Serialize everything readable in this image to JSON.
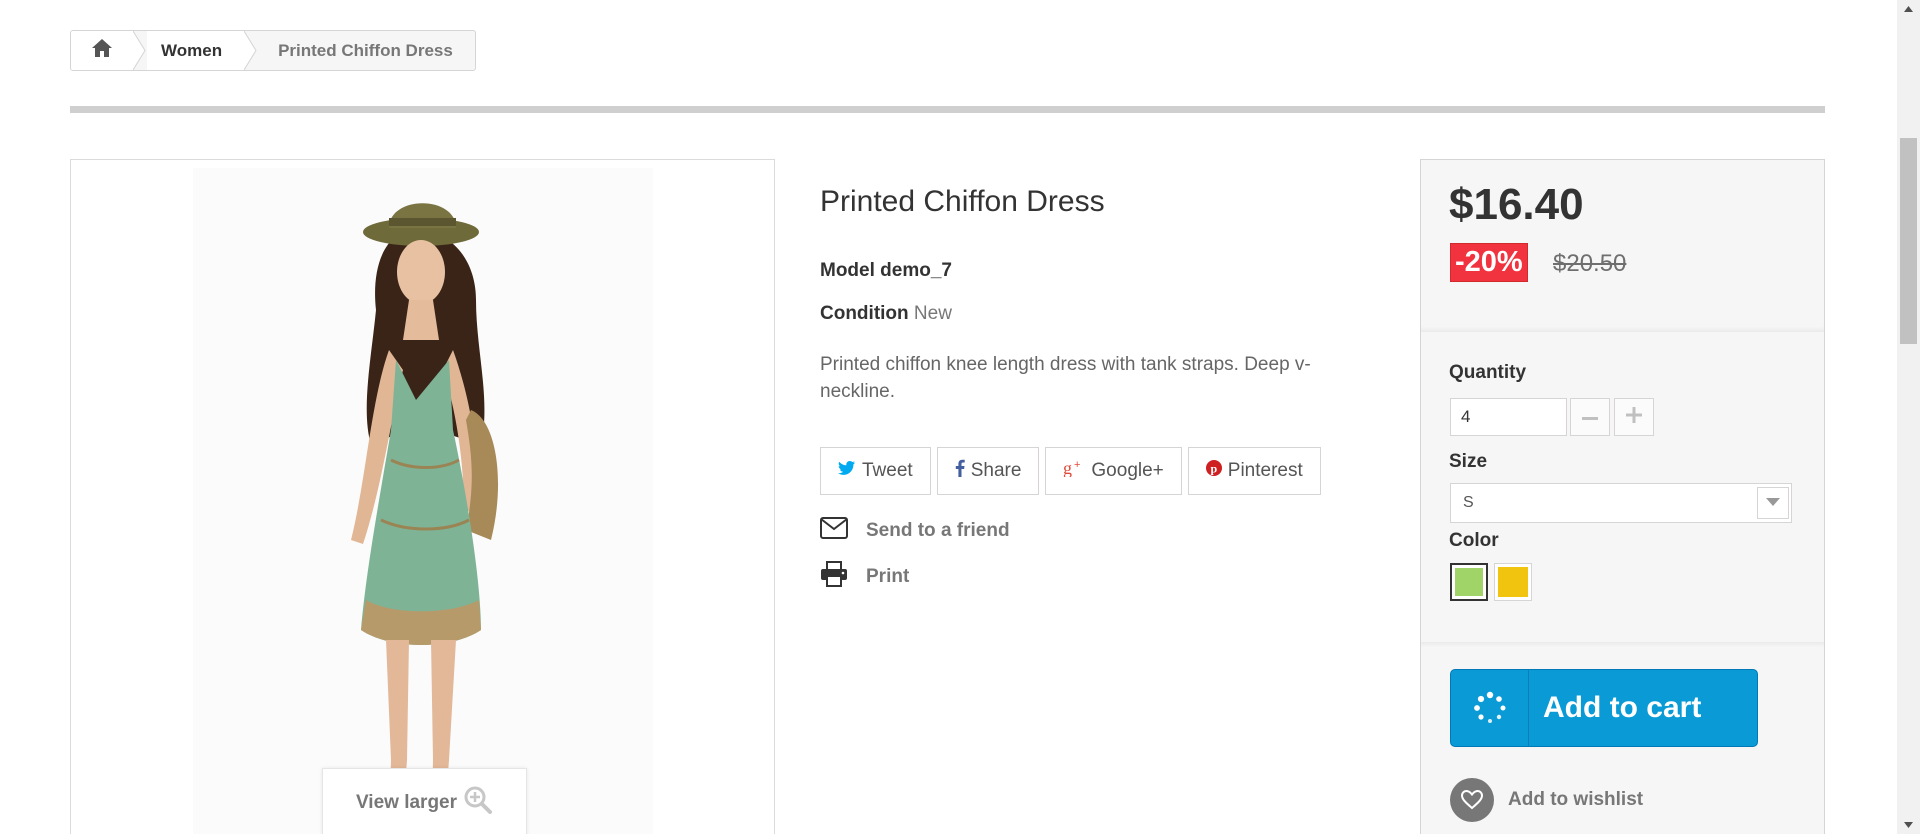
{
  "breadcrumb": {
    "home_icon": "home-icon",
    "women": "Women",
    "current": "Printed Chiffon Dress"
  },
  "image": {
    "view_larger": "View larger",
    "zoom_icon": "zoom-in-icon"
  },
  "product": {
    "title": "Printed Chiffon Dress",
    "model_label": "Model",
    "model_value": "demo_7",
    "condition_label": "Condition",
    "condition_value": "New",
    "description": "Printed chiffon knee length dress with tank straps. Deep v-neckline."
  },
  "social": {
    "tweet": "Tweet",
    "share": "Share",
    "google_plus": "Google+",
    "pinterest": "Pinterest"
  },
  "links": {
    "send_to_friend": "Send to a friend",
    "print": "Print"
  },
  "buy_box": {
    "price": "$16.40",
    "discount": "-20%",
    "old_price": "$20.50",
    "quantity_label": "Quantity",
    "quantity_value": "4",
    "size_label": "Size",
    "size_value": "S",
    "color_label": "Color",
    "colors": [
      "#a0d468",
      "#f1c40f"
    ],
    "add_to_cart": "Add to cart",
    "add_to_wishlist": "Add to wishlist"
  },
  "colors": {
    "accent_blue": "#0a9bd6",
    "discount_red": "#f13340"
  }
}
